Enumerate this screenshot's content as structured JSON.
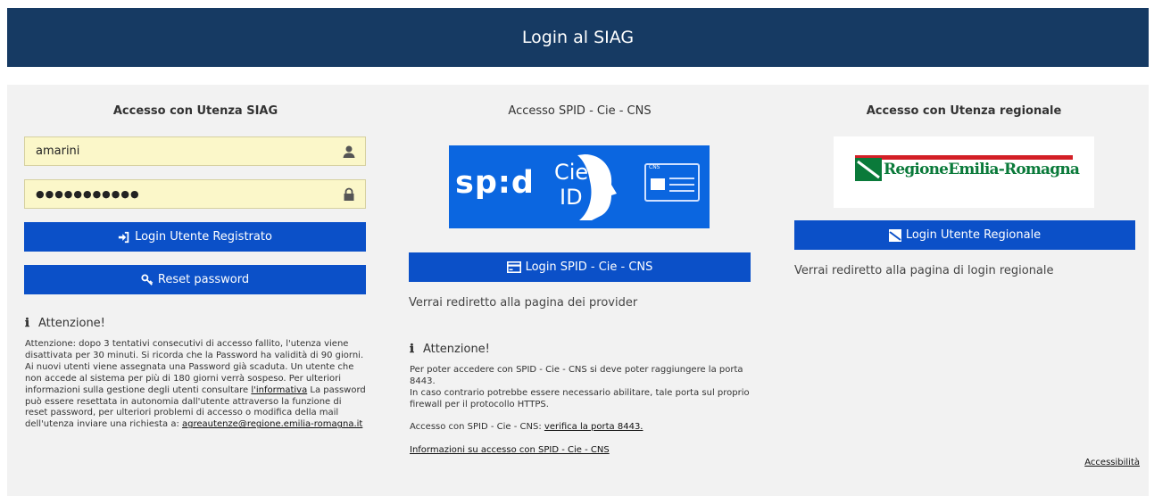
{
  "header": {
    "title": "Login al SIAG"
  },
  "siag": {
    "title": "Accesso con Utenza SIAG",
    "username_value": "amarini",
    "password_value": "●●●●●●●●●●●",
    "login_label": "Login Utente Registrato",
    "reset_label": "Reset password",
    "attention_title": "Attenzione!",
    "attention_text_1": "Attenzione: dopo 3 tentativi consecutivi di accesso fallito, l'utenza viene disattivata per 30 minuti. Si ricorda che la Password ha validità di 90 giorni. Ai nuovi utenti viene assegnata una Password già scaduta. Un utente che non accede al sistema per più di 180 giorni verrà sospeso. Per ulteriori informazioni sulla gestione degli utenti consultare ",
    "attention_link": "l'informativa",
    "attention_text_2": " La password può essere resettata in autonomia dall'utente attraverso la funzione di reset password, per ulteriori problemi di accesso o modifica della mail dell'utenza inviare una richiesta a: ",
    "attention_email": "agreautenze@regione.emilia-romagna.it"
  },
  "spid": {
    "title": "Accesso SPID - Cie - CNS",
    "logo_spid": "sp:d",
    "logo_cie_1": "Cie",
    "logo_cie_2": "ID",
    "logo_cns": "CNS",
    "login_label": "Login SPID - Cie - CNS",
    "redirect_text": "Verrai rediretto alla pagina dei provider",
    "attention_title": "Attenzione!",
    "attention_text_1": "Per poter accedere con SPID - Cie - CNS si deve poter raggiungere la porta 8443.",
    "attention_text_2": "In caso contrario potrebbe essere necessario abilitare, tale porta sul proprio firewall per il protocollo HTTPS.",
    "verify_prefix": "Accesso con SPID - Cie - CNS: ",
    "verify_link": "verifica la porta 8443.",
    "info_link": "Informazioni su accesso con SPID - Cie - CNS"
  },
  "regionale": {
    "title": "Accesso con Utenza regionale",
    "logo_text": "RegioneEmilia-Romagna",
    "login_label": "Login Utente Regionale",
    "redirect_text": "Verrai rediretto alla pagina di login regionale"
  },
  "footer": {
    "accessibility_link": "Accessibilità"
  },
  "colors": {
    "header": "#163a63",
    "button": "#0b50c8",
    "spid_blue": "#0b66e0",
    "input_bg": "#fbf7c9",
    "rer_green": "#0a7a3a",
    "rer_red": "#d31f26"
  }
}
